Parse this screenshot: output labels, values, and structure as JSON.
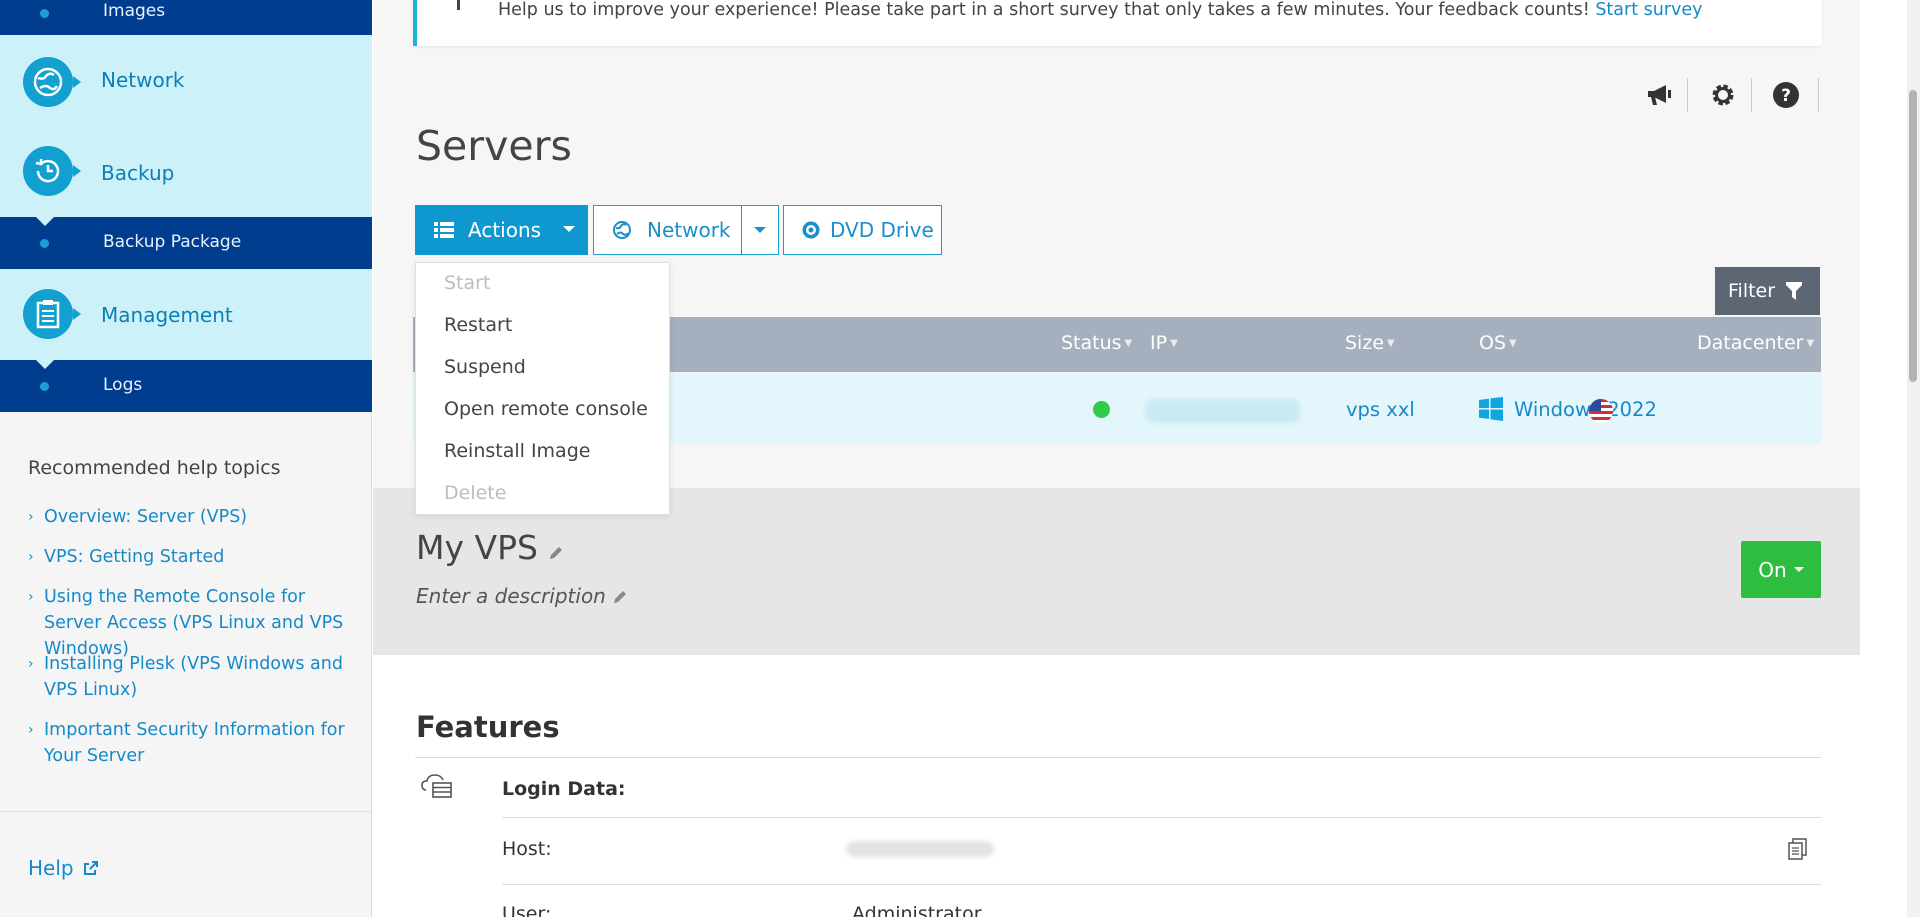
{
  "sidebar": {
    "top_sub_label": "Images",
    "items": [
      {
        "label": "Network",
        "icon": "network-globe-icon"
      },
      {
        "label": "Backup",
        "icon": "backup-clock-icon",
        "sub": "Backup Package"
      },
      {
        "label": "Management",
        "icon": "clipboard-icon",
        "sub": "Logs"
      }
    ],
    "help_heading": "Recommended help topics",
    "help_links": [
      "Overview: Server (VPS)",
      "VPS: Getting Started",
      "Using the Remote Console for Server Access (VPS Linux and VPS Windows)",
      "Installing Plesk (VPS Windows and VPS Linux)",
      "Important Security Information for Your Server"
    ],
    "help_label": "Help"
  },
  "survey": {
    "text": "Help us to improve your experience! Please take part in a short survey that only takes a few minutes. Your feedback counts!",
    "link": "Start survey"
  },
  "page_title": "Servers",
  "toolbar": {
    "actions_label": "Actions",
    "network_label": "Network",
    "dvd_label": "DVD Drive"
  },
  "actions_menu": [
    {
      "label": "Start",
      "disabled": true
    },
    {
      "label": "Restart",
      "disabled": false
    },
    {
      "label": "Suspend",
      "disabled": false
    },
    {
      "label": "Open remote console",
      "disabled": false
    },
    {
      "label": "Reinstall Image",
      "disabled": false
    },
    {
      "label": "Delete",
      "disabled": true
    }
  ],
  "filter_label": "Filter",
  "table": {
    "headers": {
      "status": "Status",
      "ip": "IP",
      "size": "Size",
      "os": "OS",
      "datacenter": "Datacenter"
    },
    "row": {
      "status": "running",
      "size": "vps xxl",
      "os": "Windows 2022"
    }
  },
  "server": {
    "name": "My VPS",
    "description_placeholder": "Enter a description",
    "power_state": "On"
  },
  "features": {
    "title": "Features",
    "login_data": "Login Data:",
    "host_label": "Host:",
    "user_label": "User:",
    "user_value": "Administrator"
  },
  "colors": {
    "accent": "#0f98cf",
    "sidebar_dark": "#003d8f",
    "sidebar_light": "#cdf1f9",
    "on_green": "#2dbe3f"
  }
}
